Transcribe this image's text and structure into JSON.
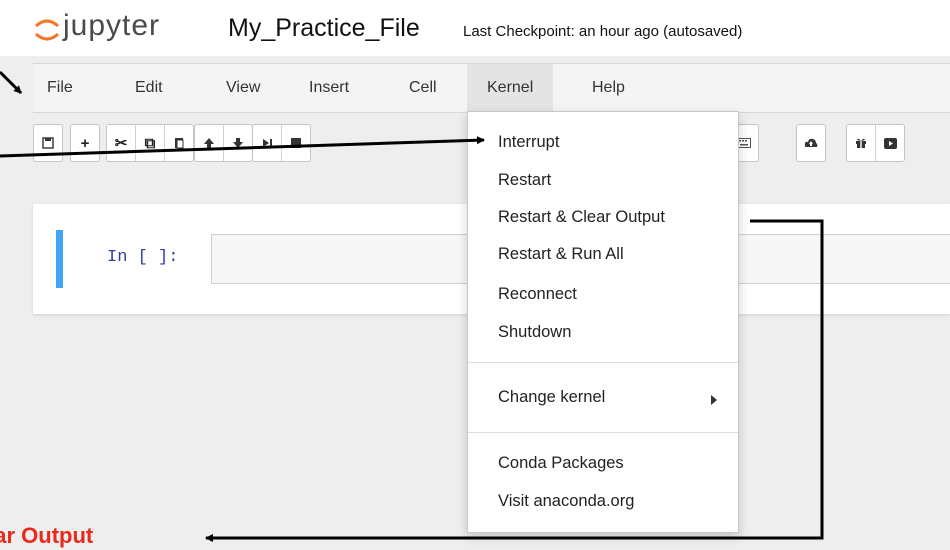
{
  "header": {
    "logo_text": "jupyter",
    "notebook_name": "My_Practice_File",
    "checkpoint": "Last Checkpoint: an hour ago (autosaved)"
  },
  "menubar": {
    "items": [
      "File",
      "Edit",
      "View",
      "Insert",
      "Cell",
      "Kernel",
      "Help"
    ],
    "active": "Kernel"
  },
  "toolbar": {
    "icons": [
      "save-icon",
      "plus-icon",
      "scissors-icon",
      "copy-icon",
      "paste-icon",
      "arrow-up-icon",
      "arrow-down-icon",
      "step-forward-icon",
      "stop-icon",
      "keyboard-icon",
      "cloud-upload-icon",
      "gift-icon",
      "presentation-icon"
    ]
  },
  "cell": {
    "prompt": "In [ ]:"
  },
  "kernel_menu": {
    "items": [
      "Interrupt",
      "Restart",
      "Restart & Clear Output",
      "Restart & Run All",
      "Reconnect",
      "Shutdown",
      "Change kernel",
      "Conda Packages",
      "Visit anaconda.org"
    ]
  },
  "annotation": {
    "text": "ear Output",
    "color": "#e8291c"
  },
  "colors": {
    "logo_orange": "#f37726",
    "cell_accent": "#42a5f5",
    "prompt": "#303f9f"
  }
}
